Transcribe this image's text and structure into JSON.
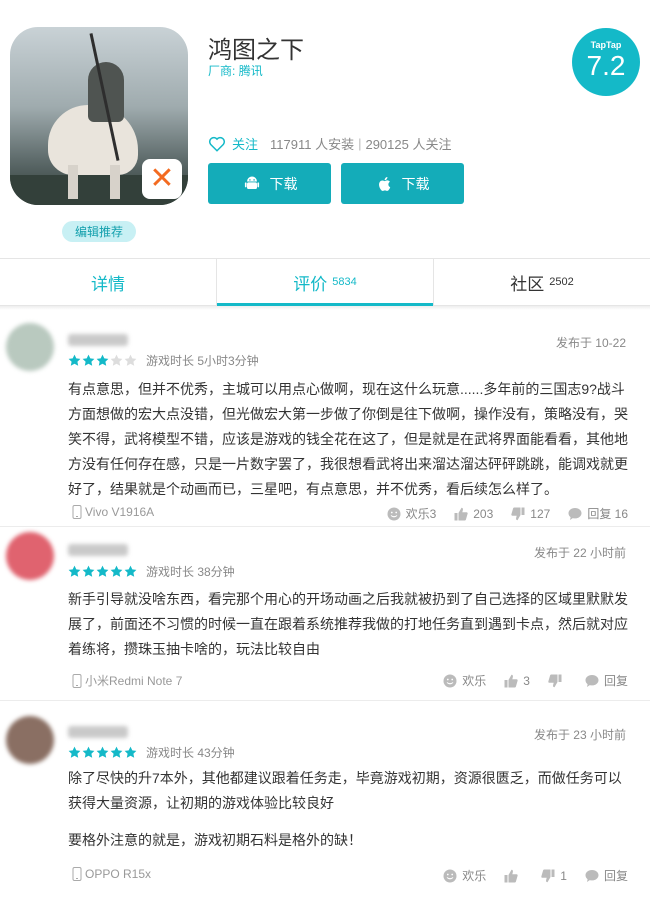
{
  "app": {
    "title": "鸿图之下",
    "vendor_label": "厂商:",
    "vendor_name": "腾讯",
    "taptap_brand": "TapTap",
    "score": "7.2",
    "follow_label": "关注",
    "installs": "117911 人安装",
    "separator": "|",
    "followers": "290125 人关注",
    "download_android": "下载",
    "download_ios": "下载",
    "editor_tag": "编辑推荐"
  },
  "tabs": [
    {
      "label": "详情",
      "count": ""
    },
    {
      "label": "评价",
      "count": "5834"
    },
    {
      "label": "社区",
      "count": "2502"
    }
  ],
  "reviews": [
    {
      "rating": 3,
      "playtime": "游戏时长 5小时3分钟",
      "posted": "发布于 10-22",
      "text": [
        "有点意思，但并不优秀，主城可以用点心做啊，现在这什么玩意......多年前的三国志9?战斗方面想做的宏大点没错，但光做宏大第一步做了你倒是往下做啊，操作没有，策略没有，哭笑不得，武将模型不错，应该是游戏的钱全花在这了，但是就是在武将界面能看看，其他地方没有任何存在感，只是一片数字罢了，我很想看武将出来溜达溜达砰砰跳跳，能调戏就更好了，结果就是个动画而已，三星吧，有点意思，并不优秀，看后续怎么样了。"
      ],
      "device": "Vivo V1916A",
      "fun": "欢乐3",
      "likes": "203",
      "dislikes": "127",
      "replies": "回复 16",
      "avatar_color": "#b9c9bf"
    },
    {
      "rating": 5,
      "playtime": "游戏时长 38分钟",
      "posted": "发布于 22 小时前",
      "text": [
        "新手引导就没啥东西，看完那个用心的开场动画之后我就被扔到了自己选择的区域里默默发展了，前面还不习惯的时候一直在跟着系统推荐我做的打地任务直到遇到卡点，然后就对应着练将，攒珠玉抽卡啥的，玩法比较自由"
      ],
      "device": "小米Redmi Note 7",
      "fun": "欢乐",
      "likes": "3",
      "dislikes": "",
      "replies": "回复",
      "avatar_color": "#e0636f"
    },
    {
      "rating": 5,
      "playtime": "游戏时长 43分钟",
      "posted": "发布于 23 小时前",
      "text": [
        "除了尽快的升7本外，其他都建议跟着任务走，毕竟游戏初期，资源很匮乏，而做任务可以获得大量资源，让初期的游戏体验比较良好",
        "要格外注意的就是，游戏初期石料是格外的缺！"
      ],
      "device": "OPPO R15x",
      "fun": "欢乐",
      "likes": "",
      "dislikes": "1",
      "replies": "回复",
      "avatar_color": "#8a6f63"
    }
  ],
  "colors": {
    "accent": "#14b9c8",
    "button": "#14acb9",
    "star_on": "#14b9c8",
    "star_off": "#dddddd"
  }
}
